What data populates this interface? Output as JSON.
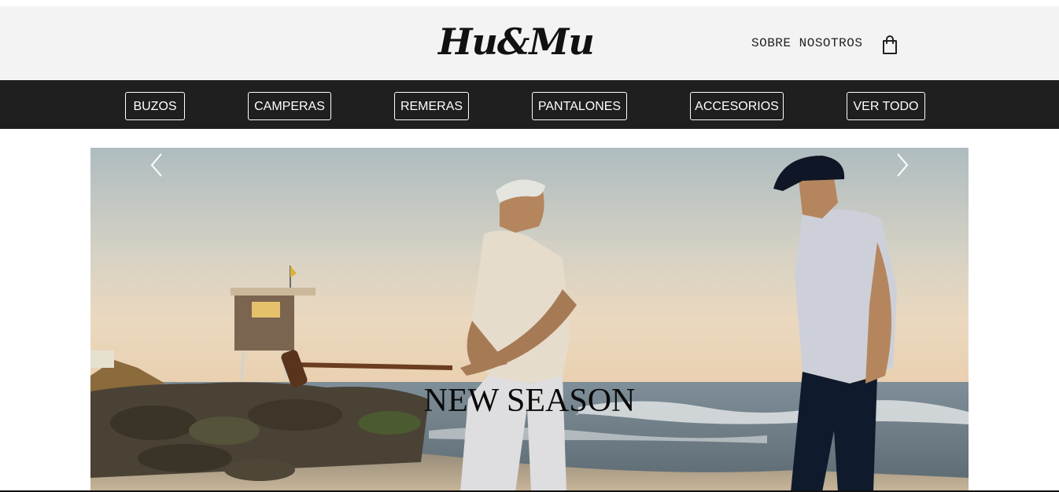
{
  "header": {
    "logo": "Hu&Mu",
    "about_link": "SOBRE NOSOTROS",
    "cart_icon": "shopping-bag-icon"
  },
  "nav": {
    "items": [
      {
        "label": "BUZOS"
      },
      {
        "label": "CAMPERAS"
      },
      {
        "label": "REMERAS"
      },
      {
        "label": "PANTALONES"
      },
      {
        "label": "ACCESORIOS"
      },
      {
        "label": "VER TODO"
      }
    ]
  },
  "hero": {
    "caption": "NEW SEASON",
    "prev_icon": "chevron-left-icon",
    "next_icon": "chevron-right-icon"
  },
  "colors": {
    "header_bg": "#f3f3f3",
    "nav_bg": "#1f1f1f",
    "nav_text": "#ffffff"
  }
}
